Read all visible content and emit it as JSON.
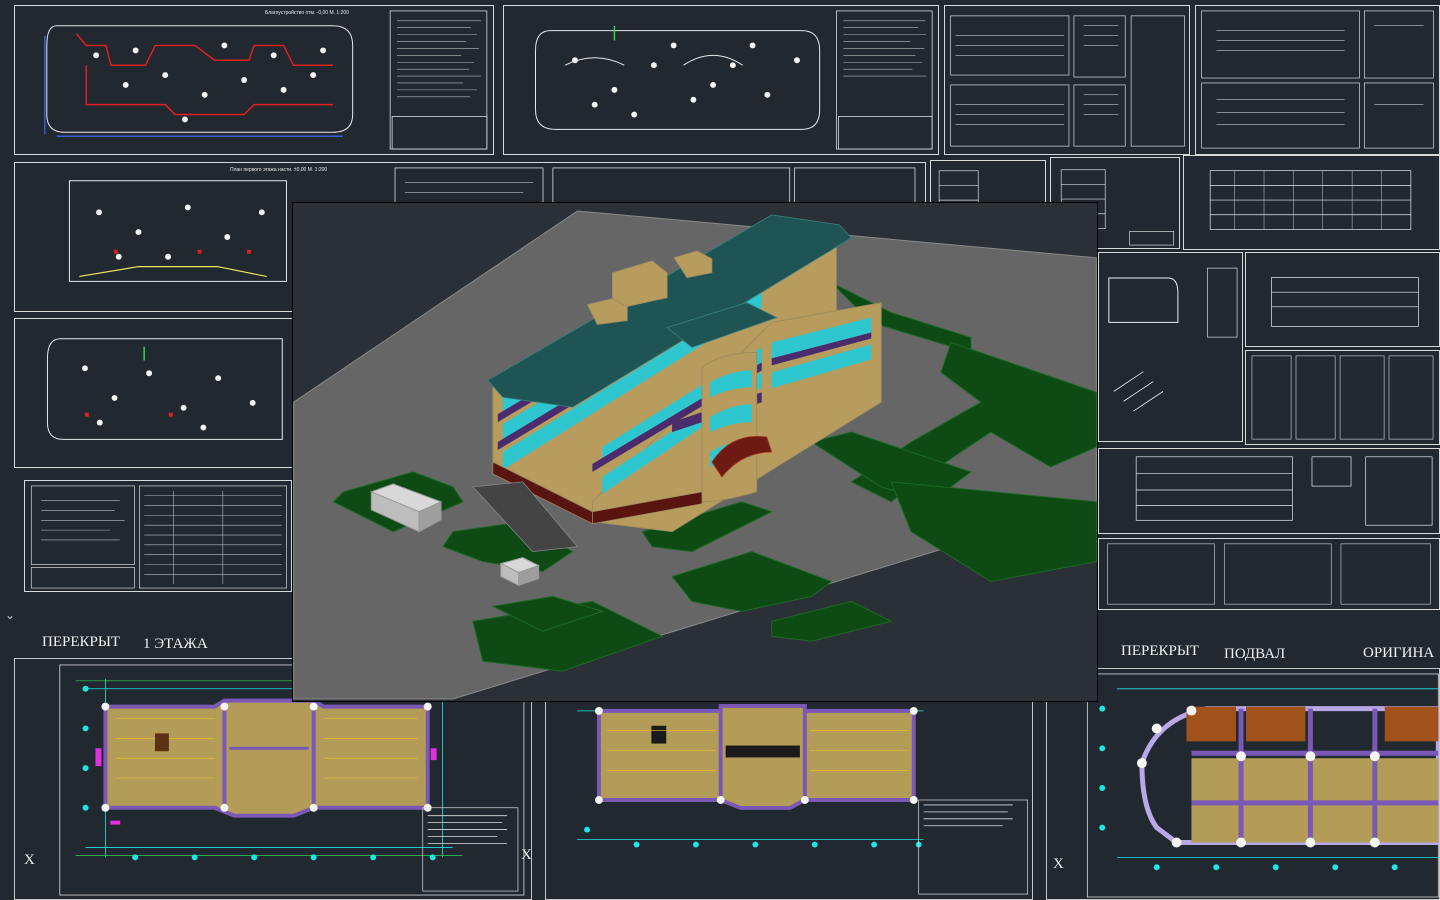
{
  "labels": {
    "top_left_1": "ПЕРЕКРЫТ",
    "top_left_2": "1 ЭТАЖА",
    "top_right_1": "ПЕРЕКРЫТ",
    "top_right_2": "ПОДВАЛ",
    "top_right_3": "ОРИГИНА",
    "x_mark": "X"
  },
  "sheet_titles": {
    "plan_a": "Благоустройство отм. -0,00  М. 1:200",
    "plan_b": "План первого этажа насти. ±0,00  М. 1:200"
  },
  "colors": {
    "background": "#212830",
    "viewport": "#2a3036",
    "facade": "#b79c5e",
    "glass": "#2ec6cf",
    "roof": "#1e5554",
    "lawn": "#0d4a14",
    "ground": "#666666",
    "band": "#4a2c6e",
    "floorplan_fill": "#b39b58",
    "wall": "#7b58b5",
    "grid_cyan": "#1ee6e6",
    "grid_green": "#2fd84a",
    "red_line": "#e02020"
  },
  "icons": {
    "close_mark": "X",
    "collapse": "chevron-down-icon"
  }
}
